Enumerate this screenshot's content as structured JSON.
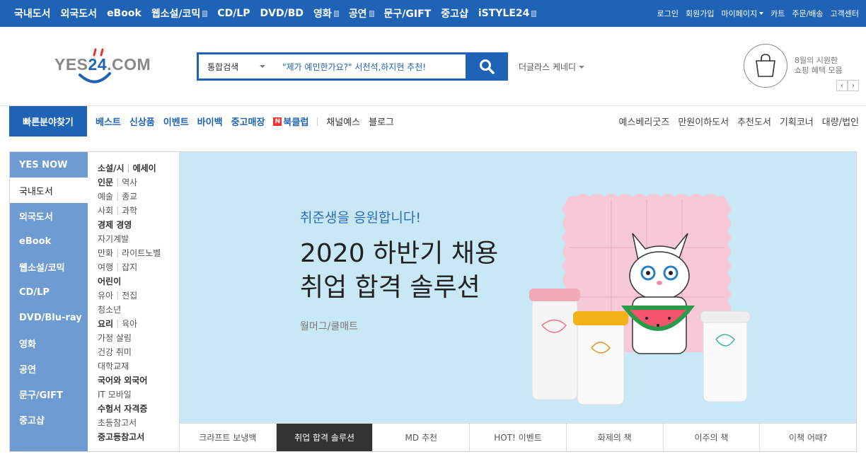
{
  "topbar": {
    "categories": [
      {
        "label": "국내도서",
        "ext": false
      },
      {
        "label": "외국도서",
        "ext": false
      },
      {
        "label": "eBook",
        "ext": false
      },
      {
        "label": "웹소설/코믹",
        "ext": true
      },
      {
        "label": "CD/LP",
        "ext": false
      },
      {
        "label": "DVD/BD",
        "ext": false
      },
      {
        "label": "영화",
        "ext": true
      },
      {
        "label": "공연",
        "ext": true
      },
      {
        "label": "문구/GIFT",
        "ext": false
      },
      {
        "label": "중고샵",
        "ext": false
      },
      {
        "label": "iSTYLE24",
        "ext": true
      }
    ],
    "util": {
      "login": "로그인",
      "join": "회원가입",
      "mypage": "마이페이지",
      "cart": "카트",
      "orders": "주문/배송",
      "support": "고객센터"
    }
  },
  "header": {
    "logo_text_left": "YES",
    "logo_text_num": "24",
    "logo_text_right": ".COM",
    "search": {
      "scope": "통합검색",
      "query": "\"제가 예민한가요?\" 서천석,하지현 추천!"
    },
    "author_suggestion": "더글라스 케네디",
    "promo_line1": "8월의 시원한",
    "promo_line2": "쇼핑 혜택 모음",
    "pager_prev": "‹",
    "pager_next": "›"
  },
  "subnav": {
    "quick": "빠른분야찾기",
    "left_links": [
      "베스트",
      "신상품",
      "이벤트",
      "바이백",
      "중고매장"
    ],
    "bookclub_icon": "N",
    "bookclub": "북클럽",
    "after_sep": [
      "채널예스",
      "블로그"
    ],
    "right_links": [
      "예스베리굿즈",
      "만원이하도서",
      "추천도서",
      "기획코너",
      "대량/법인"
    ]
  },
  "leftnav": {
    "items": [
      "YES NOW",
      "국내도서",
      "외국도서",
      "eBook",
      "웹소설/코믹",
      "CD/LP",
      "DVD/Blu-ray",
      "영화",
      "공연",
      "문구/GIFT",
      "중고샵"
    ],
    "active_index": 1
  },
  "subcategories": [
    [
      {
        "t": "소설/시",
        "b": true
      },
      {
        "t": "에세이",
        "b": true
      }
    ],
    [
      {
        "t": "인문",
        "b": true
      },
      {
        "t": "역사",
        "b": false
      }
    ],
    [
      {
        "t": "예술",
        "b": false
      },
      {
        "t": "종교",
        "b": false
      }
    ],
    [
      {
        "t": "사회",
        "b": false
      },
      {
        "t": "과학",
        "b": false
      }
    ],
    [
      {
        "t": "경제 경영",
        "b": true
      }
    ],
    [
      {
        "t": "자기계발",
        "b": false
      }
    ],
    [
      {
        "t": "만화",
        "b": false
      },
      {
        "t": "라이트노벨",
        "b": false
      }
    ],
    [
      {
        "t": "여행",
        "b": false
      },
      {
        "t": "잡지",
        "b": false
      }
    ],
    [
      {
        "t": "어린이",
        "b": true
      }
    ],
    [
      {
        "t": "유아",
        "b": false
      },
      {
        "t": "전집",
        "b": false
      }
    ],
    [
      {
        "t": "청소년",
        "b": false
      }
    ],
    [
      {
        "t": "요리",
        "b": true
      },
      {
        "t": "육아",
        "b": false
      }
    ],
    [
      {
        "t": "가정 살림",
        "b": false
      }
    ],
    [
      {
        "t": "건강 취미",
        "b": false
      }
    ],
    [
      {
        "t": "대학교재",
        "b": false
      }
    ],
    [
      {
        "t": "국어와 외국어",
        "b": true
      }
    ],
    [
      {
        "t": "IT 모바일",
        "b": false
      }
    ],
    [
      {
        "t": "수험서 자격증",
        "b": true
      }
    ],
    [
      {
        "t": "초등참고서",
        "b": false
      }
    ],
    [
      {
        "t": "중고등참고서",
        "b": true
      }
    ]
  ],
  "banner": {
    "subtitle": "취준생을 응원합니다!",
    "title_line1": "2020 하반기 채용",
    "title_line2": "취업 합격 솔루션",
    "product": "월머그/쿨매트",
    "bg_color": "#c8e8f6"
  },
  "tabs": {
    "items": [
      "크라프트 보냉백",
      "취업 합격 솔루션",
      "MD 추천",
      "HOT! 이벤트",
      "화제의 책",
      "이주의 책",
      "이책 어때?"
    ],
    "active_index": 1
  },
  "colors": {
    "brand_blue": "#1e63b6",
    "leftnav_blue": "#6d9bd2"
  }
}
